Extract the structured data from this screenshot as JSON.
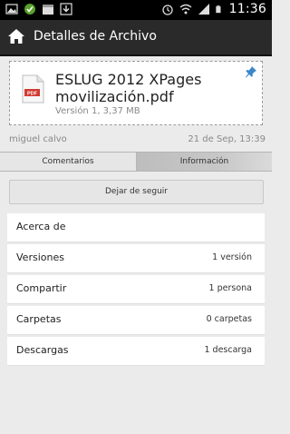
{
  "status_bar": {
    "time": "11:36"
  },
  "action_bar": {
    "title": "Detalles de Archivo"
  },
  "file": {
    "type_badge": "PDF",
    "title": "ESLUG 2012 XPages movilización.pdf",
    "subtitle": "Versión 1, 3,37 MB"
  },
  "meta": {
    "user": "miguel calvo",
    "date": "21 de Sep, 13:39"
  },
  "tabs": [
    {
      "label": "Comentarios"
    },
    {
      "label": "Información"
    }
  ],
  "follow_button": {
    "label": "Dejar de seguir"
  },
  "info": [
    {
      "label": "Acerca de",
      "value": ""
    },
    {
      "label": "Versiones",
      "value": "1 versión"
    },
    {
      "label": "Compartir",
      "value": "1 persona"
    },
    {
      "label": "Carpetas",
      "value": "0 carpetas"
    },
    {
      "label": "Descargas",
      "value": "1 descarga"
    }
  ]
}
